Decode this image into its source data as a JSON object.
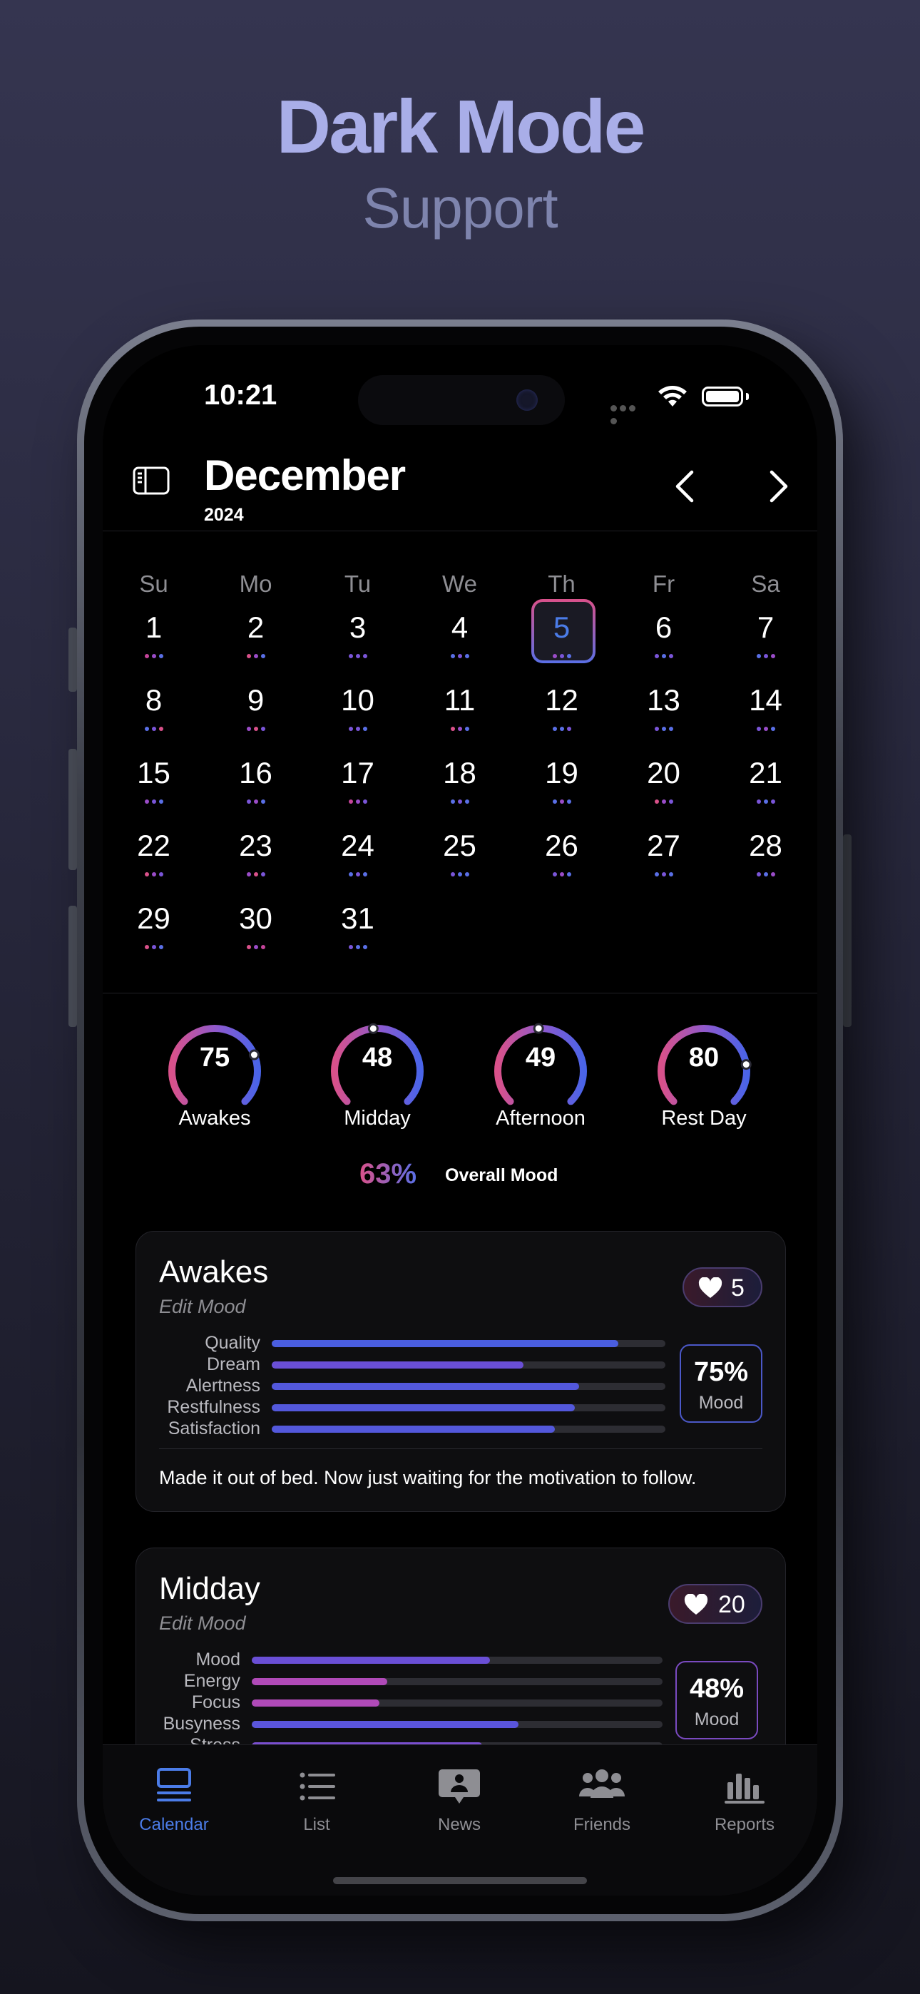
{
  "promo": {
    "title": "Dark Mode",
    "subtitle": "Support"
  },
  "status_bar": {
    "time": "10:21"
  },
  "header": {
    "month": "December",
    "year": "2024"
  },
  "calendar": {
    "weekdays": [
      "Su",
      "Mo",
      "Tu",
      "We",
      "Th",
      "Fr",
      "Sa"
    ],
    "today": 5,
    "days": [
      {
        "n": "1",
        "dots": [
          "#c4449a",
          "#9a4cc8",
          "#5a6fe6"
        ]
      },
      {
        "n": "2",
        "dots": [
          "#d9518a",
          "#9a4cc8",
          "#5a6fe6"
        ]
      },
      {
        "n": "3",
        "dots": [
          "#7a55d8",
          "#7a55d8",
          "#7a55d8"
        ]
      },
      {
        "n": "4",
        "dots": [
          "#5a6fe6",
          "#7a55d8",
          "#5a6fe6"
        ]
      },
      {
        "n": "5",
        "dots": [
          "#9a4cc8",
          "#7a55d8",
          "#5a6fe6"
        ]
      },
      {
        "n": "6",
        "dots": [
          "#7a55d8",
          "#5a6fe6",
          "#7a55d8"
        ]
      },
      {
        "n": "7",
        "dots": [
          "#5a6fe6",
          "#7a55d8",
          "#9a4cc8"
        ]
      },
      {
        "n": "8",
        "dots": [
          "#5a6fe6",
          "#7a55d8",
          "#d9518a"
        ]
      },
      {
        "n": "9",
        "dots": [
          "#9a4cc8",
          "#d9518a",
          "#7a55d8"
        ]
      },
      {
        "n": "10",
        "dots": [
          "#7a55d8",
          "#7a55d8",
          "#5a6fe6"
        ]
      },
      {
        "n": "11",
        "dots": [
          "#d9518a",
          "#9a4cc8",
          "#5a6fe6"
        ]
      },
      {
        "n": "12",
        "dots": [
          "#5a6fe6",
          "#5a6fe6",
          "#7a55d8"
        ]
      },
      {
        "n": "13",
        "dots": [
          "#7a55d8",
          "#5a6fe6",
          "#5a6fe6"
        ]
      },
      {
        "n": "14",
        "dots": [
          "#7a55d8",
          "#9a4cc8",
          "#5a6fe6"
        ]
      },
      {
        "n": "15",
        "dots": [
          "#9a4cc8",
          "#7a55d8",
          "#5a6fe6"
        ]
      },
      {
        "n": "16",
        "dots": [
          "#7a55d8",
          "#9a4cc8",
          "#5a6fe6"
        ]
      },
      {
        "n": "17",
        "dots": [
          "#c4449a",
          "#9a4cc8",
          "#7a55d8"
        ]
      },
      {
        "n": "18",
        "dots": [
          "#5a6fe6",
          "#7a55d8",
          "#5a6fe6"
        ]
      },
      {
        "n": "19",
        "dots": [
          "#5a6fe6",
          "#9a4cc8",
          "#5a6fe6"
        ]
      },
      {
        "n": "20",
        "dots": [
          "#d9518a",
          "#9a4cc8",
          "#7a55d8"
        ]
      },
      {
        "n": "21",
        "dots": [
          "#7a55d8",
          "#5a6fe6",
          "#7a55d8"
        ]
      },
      {
        "n": "22",
        "dots": [
          "#d9518a",
          "#9a4cc8",
          "#7a55d8"
        ]
      },
      {
        "n": "23",
        "dots": [
          "#9a4cc8",
          "#d9518a",
          "#7a55d8"
        ]
      },
      {
        "n": "24",
        "dots": [
          "#5a6fe6",
          "#7a55d8",
          "#5a6fe6"
        ]
      },
      {
        "n": "25",
        "dots": [
          "#7a55d8",
          "#5a6fe6",
          "#5a6fe6"
        ]
      },
      {
        "n": "26",
        "dots": [
          "#7a55d8",
          "#9a4cc8",
          "#5a6fe6"
        ]
      },
      {
        "n": "27",
        "dots": [
          "#5a6fe6",
          "#7a55d8",
          "#5a6fe6"
        ]
      },
      {
        "n": "28",
        "dots": [
          "#7a55d8",
          "#5a6fe6",
          "#9a4cc8"
        ]
      },
      {
        "n": "29",
        "dots": [
          "#d9518a",
          "#7a55d8",
          "#5a6fe6"
        ]
      },
      {
        "n": "30",
        "dots": [
          "#d9518a",
          "#9a4cc8",
          "#c4449a"
        ]
      },
      {
        "n": "31",
        "dots": [
          "#7a55d8",
          "#5a6fe6",
          "#5a6fe6"
        ]
      }
    ]
  },
  "gauges": [
    {
      "value": "75",
      "label": "Awakes",
      "fraction": 0.75
    },
    {
      "value": "48",
      "label": "Midday",
      "fraction": 0.48
    },
    {
      "value": "49",
      "label": "Afternoon",
      "fraction": 0.49
    },
    {
      "value": "80",
      "label": "Rest Day",
      "fraction": 0.8
    }
  ],
  "overall": {
    "percent": "63%",
    "label": "Overall Mood"
  },
  "cards": [
    {
      "title": "Awakes",
      "edit": "Edit Mood",
      "hearts": "5",
      "mood_percent": "75%",
      "mood_label": "Mood",
      "metrics": [
        {
          "label": "Quality",
          "fraction": 0.88,
          "color": "#4a5ee0"
        },
        {
          "label": "Dream",
          "fraction": 0.64,
          "color": "#6a4fd6"
        },
        {
          "label": "Alertness",
          "fraction": 0.78,
          "color": "#5358dc"
        },
        {
          "label": "Restfulness",
          "fraction": 0.77,
          "color": "#5358dc"
        },
        {
          "label": "Satisfaction",
          "fraction": 0.72,
          "color": "#5358dc"
        }
      ],
      "note": "Made it out of bed. Now just waiting for the motivation to follow."
    },
    {
      "title": "Midday",
      "edit": "Edit Mood",
      "hearts": "20",
      "mood_percent": "48%",
      "mood_label": "Mood",
      "metrics": [
        {
          "label": "Mood",
          "fraction": 0.58,
          "color": "#6a4fd6"
        },
        {
          "label": "Energy",
          "fraction": 0.33,
          "color": "#b04ab8"
        },
        {
          "label": "Focus",
          "fraction": 0.31,
          "color": "#b04ab8"
        },
        {
          "label": "Busyness",
          "fraction": 0.65,
          "color": "#5a55dc"
        },
        {
          "label": "Stress",
          "fraction": 0.56,
          "color": "#7a4fd0"
        }
      ]
    }
  ],
  "tabbar": [
    {
      "label": "Calendar",
      "icon": "calendar-icon",
      "active": true
    },
    {
      "label": "List",
      "icon": "list-icon",
      "active": false
    },
    {
      "label": "News",
      "icon": "news-icon",
      "active": false
    },
    {
      "label": "Friends",
      "icon": "friends-icon",
      "active": false
    },
    {
      "label": "Reports",
      "icon": "reports-icon",
      "active": false
    }
  ],
  "colors": {
    "accent": "#4b7ce8",
    "gradient_start": "#d9518a",
    "gradient_end": "#5a6fe6"
  }
}
